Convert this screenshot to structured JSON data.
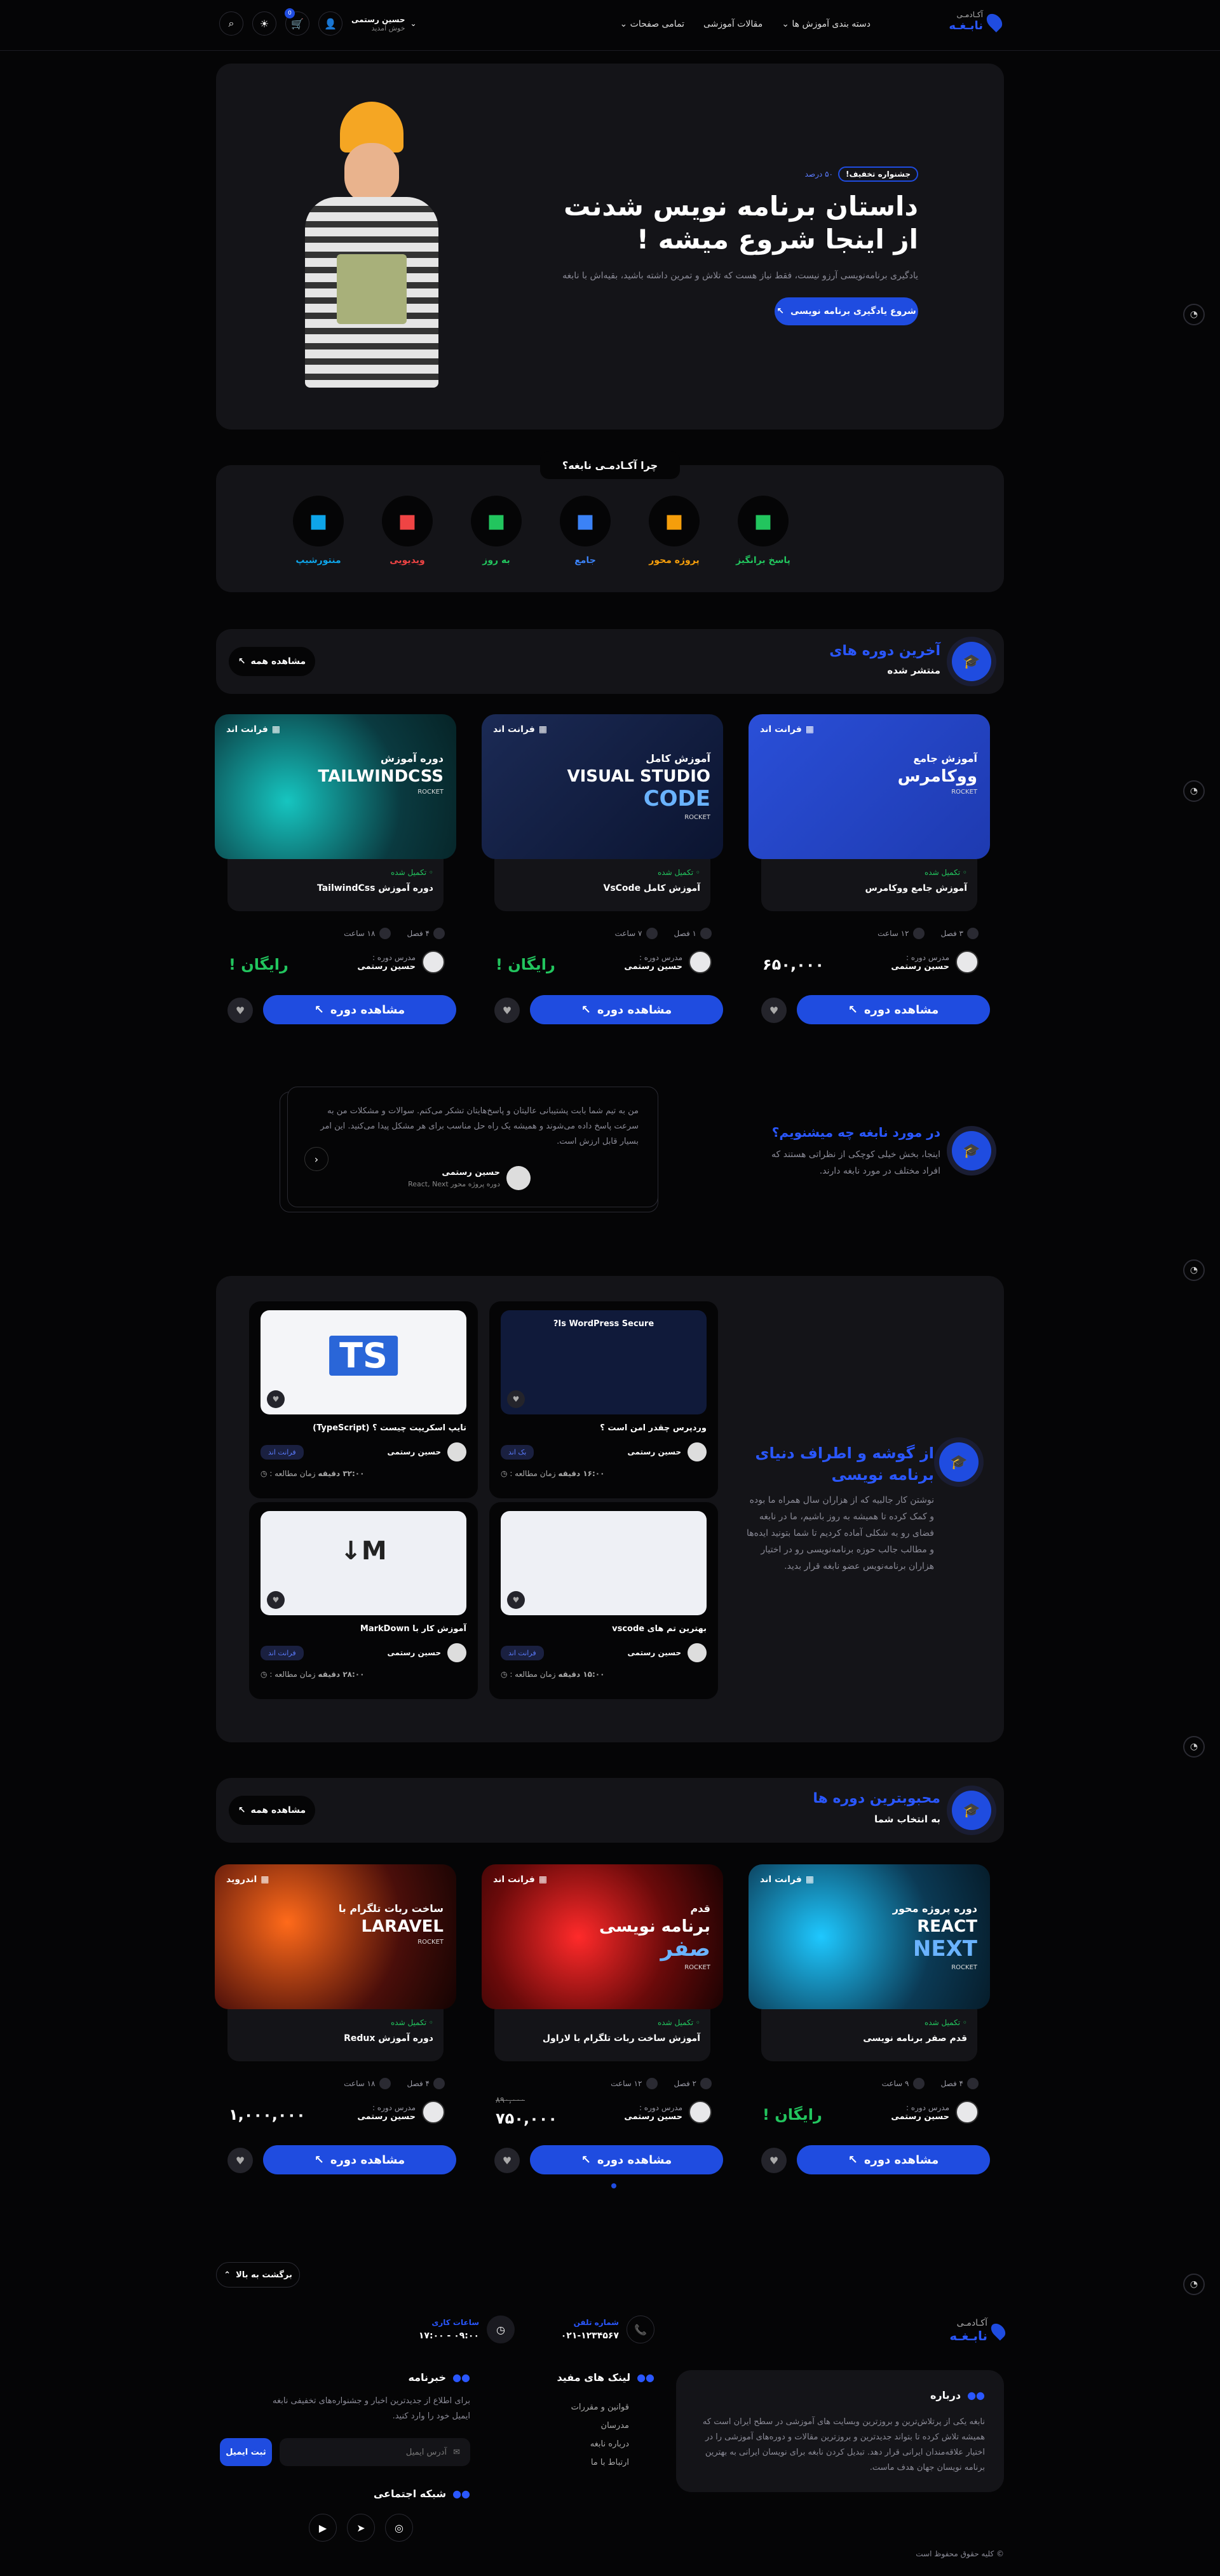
{
  "header": {
    "brand_top": "آکـادمـی",
    "brand": "نابـغـه",
    "nav": [
      "دسته بندی آموزش ها",
      "مقالات آموزشی",
      "تمامی صفحات"
    ],
    "user_name": "حسین رستمی",
    "user_sub": "خوش آمدید",
    "cart_count": "0"
  },
  "hero": {
    "badge": "جشنواره تخفیف!",
    "badge_sub": "۵۰ درصد",
    "title1": "داستان برنامه نویس شدنت",
    "title2": "از اینجا شروع میشه !",
    "desc": "یادگیری برنامه‌نویسی آرزو نیست، فقط نیاز هست که تلاش و تمرین داشته باشید، بقیه‌اش با نابغه",
    "cta": "شروع یادگیری برنامه نویسی"
  },
  "why": {
    "title": "چرا آکـادمـی نابغه؟",
    "items": [
      {
        "label": "پاسخ برانگیز",
        "icon": "puzzle-icon",
        "color": "#22c55e"
      },
      {
        "label": "پروژه محور",
        "icon": "fire-icon",
        "color": "#f59e0b"
      },
      {
        "label": "جامع",
        "icon": "book-icon",
        "color": "#3b82f6"
      },
      {
        "label": "به روز",
        "icon": "fast-forward-icon",
        "color": "#22c55e"
      },
      {
        "label": "ویدیویی",
        "icon": "chat-icon",
        "color": "#ef4444"
      },
      {
        "label": "منتورشیپ",
        "icon": "mentor-icon",
        "color": "#0ea5e9"
      }
    ]
  },
  "latest": {
    "title": "آخرین دوره های",
    "sub": "منتشر شده",
    "view_all": "مشاهده همه"
  },
  "popular": {
    "title": "محبوبترین دوره ها",
    "sub": "به انتخاب شما",
    "view_all": "مشاهده همه"
  },
  "common": {
    "teacher_label": "مدرس دوره :",
    "teacher": "حسین رستمی",
    "cta": "مشاهده دوره",
    "status": "تکمیل شده",
    "free": "رایگان !",
    "badge": "فرانت اند",
    "lesson_suffix": "فصل",
    "hour_suffix": "ساعت"
  },
  "courses_latest": [
    {
      "title": "آموزش جامع ووکامرس",
      "chapters": "۳ فصل",
      "hours": "۱۲ ساعت",
      "price": "۶۵۰,۰۰۰",
      "thumb_t1": "آموزش جامع",
      "thumb_t2": "ووکامرس",
      "brand": "ROCKET"
    },
    {
      "title": "آموزش کامل VsCode",
      "chapters": "۱ فصل",
      "hours": "۷ ساعت",
      "price": "رایگان !",
      "thumb_t1": "آموزش کامل",
      "thumb_t2": "VISUAL STUDIO",
      "thumb_t3": "CODE",
      "brand": "ROCKET"
    },
    {
      "title": "دوره آموزش TailwindCss",
      "chapters": "۴ فصل",
      "hours": "۱۸ ساعت",
      "price": "رایگان !",
      "thumb_t1": "دوره آموزش",
      "thumb_t2": "TAILWINDCSS",
      "brand": "ROCKET"
    }
  ],
  "testimonials": {
    "title": "در مورد نابغه چه میشنویم؟",
    "desc": "اینجا، بخش خیلی کوچکی از نظراتی هستند که افراد مختلف در مورد نابغه دارند.",
    "quote": "من به تیم شما بابت پشتیبانی عالیتان و پاسخ‌هایتان تشکر می‌کنم. سوالات و مشکلات من به سرعت پاسخ داده می‌شوند و همیشه یک راه حل مناسب برای هر مشکل پیدا می‌کنید. این امر بسیار قابل ارزش است.",
    "author": "حسین رستمی",
    "role": "دوره پروژه محور React, Next"
  },
  "articles": {
    "title": "از گوشه و اطراف دنیای برنامه نویسی",
    "desc": "نوشتن کار جالبیه که از هزاران سال همراه ما بوده و کمک کرده تا همیشه به روز باشیم، ما در نابغه فضای رو به شکلی آماده کردیم تا شما بتونید ایده‌ها و مطالب جالب حوزه برنامه‌نویسی رو در اختیار هزاران برنامه‌نویس عضو نابغه قرار بدید.",
    "read_label": "زمان مطالعه :",
    "author": "حسین رستمی",
    "items": [
      {
        "title": "وردپرس چقدر امن است ؟",
        "tag": "بک اند",
        "time": "۱۶:۰۰ دقیقه",
        "img_text": "Is WordPress Secure?"
      },
      {
        "title": "تایپ اسکریپت چیست ؟ (TypeScript)",
        "tag": "فرانت اند",
        "time": "۳۲:۰۰ دقیقه",
        "img_text": "TS"
      },
      {
        "title": "بهترین تم های vscode",
        "tag": "فرانت اند",
        "time": "۱۵:۰۰ دقیقه",
        "img_text": ""
      },
      {
        "title": "آموزش کار با MarkDown",
        "tag": "فرانت اند",
        "time": "۲۸:۰۰ دقیقه",
        "img_text": "M↓"
      }
    ]
  },
  "courses_popular": [
    {
      "title": "قدم صفر برنامه نویسی",
      "chapters": "۴ فصل",
      "hours": "۹ ساعت",
      "price": "رایگان !",
      "thumb_t1": "دوره پروژه محور",
      "thumb_t2": "REACT",
      "thumb_t3": "NEXT",
      "brand": "ROCKET",
      "badge": "فرانت اند"
    },
    {
      "title": "آموزش ساخت ربات تلگرام با لاراول",
      "chapters": "۲ فصل",
      "hours": "۱۲ ساعت",
      "price": "۷۵۰,۰۰۰",
      "old_price": "۸۹۰,۰۰۰",
      "thumb_t1": "قدم",
      "thumb_t2": "برنامه نویسی",
      "thumb_t3": "صفر",
      "brand": "ROCKET",
      "badge": "فرانت اند"
    },
    {
      "title": "دوره آموزش Redux",
      "chapters": "۴ فصل",
      "hours": "۱۸ ساعت",
      "price": "۱,۰۰۰,۰۰۰",
      "thumb_t1": "ساخت ربات تلگرام با",
      "thumb_t2": "LARAVEL",
      "brand": "ROCKET",
      "badge": "اندروید"
    }
  ],
  "footer": {
    "back_top": "برگشت به بالا",
    "brand_top": "آکـادمـی",
    "brand": "نابـغـه",
    "phone_label": "شماره تلفن",
    "phone": "۰۲۱-۱۲۳۴۵۶۷",
    "hours_label": "ساعات کاری",
    "hours": "۰۹:۰۰ - ۱۷:۰۰",
    "about_title": "درباره",
    "about_text": "نابغه یکی از پرتلاش‌ترین و بروزترین وبسایت های آموزشی در سطح ایران است که همیشه تلاش کرده تا بتواند جدیدترین و بروزترین مقالات و دوره‌های آموزشی را در اختیار علاقه‌مندان ایرانی قرار دهد. تبدیل کردن نابغه برای نویسان ایرانی به بهترین برنامه نویسان جهان هدف ماست.",
    "links_title": "لینک های مفید",
    "links": [
      "قوانین و مقررات",
      "مدرسان",
      "درباره نابغه",
      "ارتباط با ما"
    ],
    "news_title": "خبرنامه",
    "news_text": "برای اطلاع از جدیدترین اخبار و جشنواره‌های تخفیفی نابغه ایمیل خود را وارد کنید.",
    "email_placeholder": "آدرس ایمیل",
    "submit": "ثبت ایمیل",
    "social_title": "شبکه اجتماعی",
    "copyright": "© کلیه حقوق محفوظ است"
  }
}
